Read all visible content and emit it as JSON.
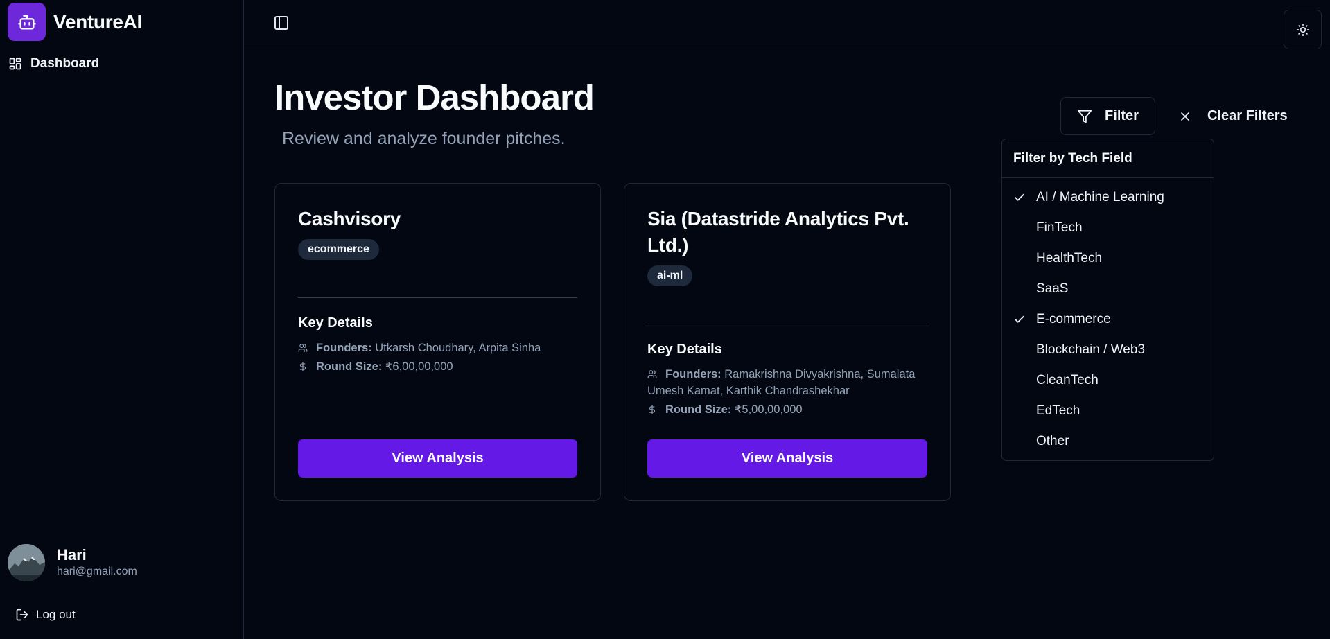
{
  "app": {
    "name": "VentureAI"
  },
  "sidebar": {
    "nav": [
      {
        "label": "Dashboard",
        "icon": "dashboard-grid-icon"
      }
    ],
    "user": {
      "name": "Hari",
      "email": "hari@gmail.com"
    },
    "logout_label": "Log out"
  },
  "header": {
    "title": "Investor Dashboard",
    "subtitle": "Review and analyze founder pitches."
  },
  "filters": {
    "filter_label": "Filter",
    "clear_label": "Clear Filters",
    "dropdown": {
      "title": "Filter by Tech Field",
      "options": [
        {
          "label": "AI / Machine Learning",
          "checked": true
        },
        {
          "label": "FinTech",
          "checked": false
        },
        {
          "label": "HealthTech",
          "checked": false
        },
        {
          "label": "SaaS",
          "checked": false
        },
        {
          "label": "E-commerce",
          "checked": true
        },
        {
          "label": "Blockchain / Web3",
          "checked": false
        },
        {
          "label": "CleanTech",
          "checked": false
        },
        {
          "label": "EdTech",
          "checked": false
        },
        {
          "label": "Other",
          "checked": false
        }
      ]
    }
  },
  "cards": [
    {
      "title": "Cashvisory",
      "tag": "ecommerce",
      "section_title": "Key Details",
      "founders_label": "Founders:",
      "founders": "Utkarsh Choudhary, Arpita Sinha",
      "round_label": "Round Size:",
      "round_size": "₹6,00,00,000",
      "cta": "View Analysis"
    },
    {
      "title": "Sia (Datastride Analytics Pvt. Ltd.)",
      "tag": "ai-ml",
      "section_title": "Key Details",
      "founders_label": "Founders:",
      "founders": "Ramakrishna Divyakrishna, Sumalata Umesh Kamat, Karthik Chandrashekhar",
      "round_label": "Round Size:",
      "round_size": "₹5,00,00,000",
      "cta": "View Analysis"
    }
  ],
  "colors": {
    "background": "#030712",
    "accent": "#6419e6",
    "border": "#1e293b",
    "muted_text": "#94a3b8"
  }
}
